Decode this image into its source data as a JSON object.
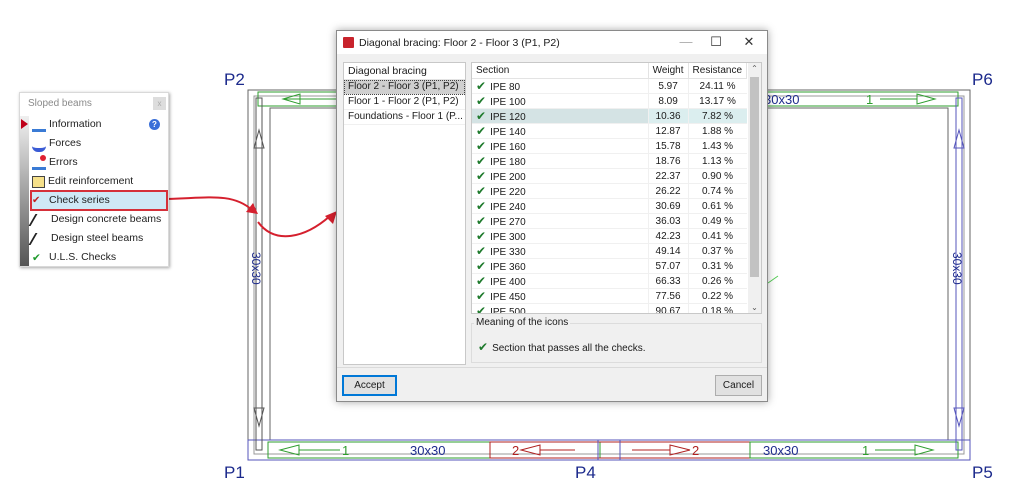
{
  "drawing": {
    "nodes": {
      "p1": "P1",
      "p2": "P2",
      "p4": "P4",
      "p5": "P5",
      "p6": "P6"
    },
    "section_label": "30x30",
    "span_1": "1",
    "span_2": "2",
    "colors": {
      "span1": "#2e9e2e",
      "span2": "#b02020",
      "column": "#1c2a8c",
      "annotation_arrow": "#d5202e"
    }
  },
  "panel": {
    "title": "Sloped beams",
    "close": "x",
    "help": "?",
    "items": [
      {
        "label": "Information",
        "icon": "information-icon"
      },
      {
        "label": "Forces",
        "icon": "forces-icon"
      },
      {
        "label": "Errors",
        "icon": "errors-icon"
      },
      {
        "label": "Edit reinforcement",
        "icon": "edit-reinforcement-icon"
      },
      {
        "label": "Check series",
        "icon": "check-series-icon",
        "selected": true
      },
      {
        "label": "Design concrete beams",
        "icon": "design-concrete-icon"
      },
      {
        "label": "Design steel beams",
        "icon": "design-steel-icon"
      },
      {
        "label": "U.L.S. Checks",
        "icon": "uls-checks-icon"
      }
    ]
  },
  "dialog": {
    "title": "Diagonal bracing: Floor 2 - Floor 3 (P1, P2)",
    "minimize": "—",
    "maximize": "☐",
    "close": "✕",
    "list_header": "Diagonal bracing",
    "list_items": [
      "Floor 2 - Floor 3 (P1, P2)",
      "Floor 1 - Floor 2 (P1, P2)",
      "Foundations - Floor 1 (P..."
    ],
    "columns": [
      "Section",
      "Weight",
      "Resistance"
    ],
    "rows": [
      [
        "IPE 80",
        "5.97",
        "24.11 %"
      ],
      [
        "IPE 100",
        "8.09",
        "13.17 %"
      ],
      [
        "IPE 120",
        "10.36",
        "7.82 %"
      ],
      [
        "IPE 140",
        "12.87",
        "1.88 %"
      ],
      [
        "IPE 160",
        "15.78",
        "1.43 %"
      ],
      [
        "IPE 180",
        "18.76",
        "1.13 %"
      ],
      [
        "IPE 200",
        "22.37",
        "0.90 %"
      ],
      [
        "IPE 220",
        "26.22",
        "0.74 %"
      ],
      [
        "IPE 240",
        "30.69",
        "0.61 %"
      ],
      [
        "IPE 270",
        "36.03",
        "0.49 %"
      ],
      [
        "IPE 300",
        "42.23",
        "0.41 %"
      ],
      [
        "IPE 330",
        "49.14",
        "0.37 %"
      ],
      [
        "IPE 360",
        "57.07",
        "0.31 %"
      ],
      [
        "IPE 400",
        "66.33",
        "0.26 %"
      ],
      [
        "IPE 450",
        "77.56",
        "0.22 %"
      ],
      [
        "IPE 500",
        "90.67",
        "0.18 %"
      ]
    ],
    "highlighted_row": 2,
    "legend_title": "Meaning of the icons",
    "legend_text": "Section that passes all the checks.",
    "accept": "Accept",
    "cancel": "Cancel"
  }
}
